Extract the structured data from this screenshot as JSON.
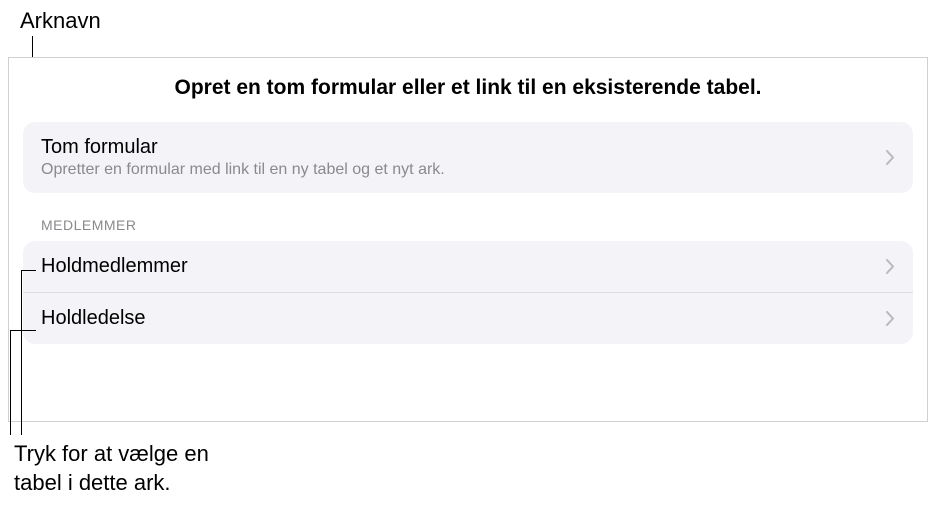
{
  "callouts": {
    "top": "Arknavn",
    "bottom_line1": "Tryk for at vælge en",
    "bottom_line2": "tabel i dette ark."
  },
  "panel": {
    "title": "Opret en tom formular eller et link til en eksisterende tabel.",
    "blank_form": {
      "title": "Tom formular",
      "subtitle": "Opretter en formular med link til en ny tabel og et nyt ark."
    },
    "section_header": "MEDLEMMER",
    "tables": [
      {
        "label": "Holdmedlemmer"
      },
      {
        "label": "Holdledelse"
      }
    ]
  }
}
